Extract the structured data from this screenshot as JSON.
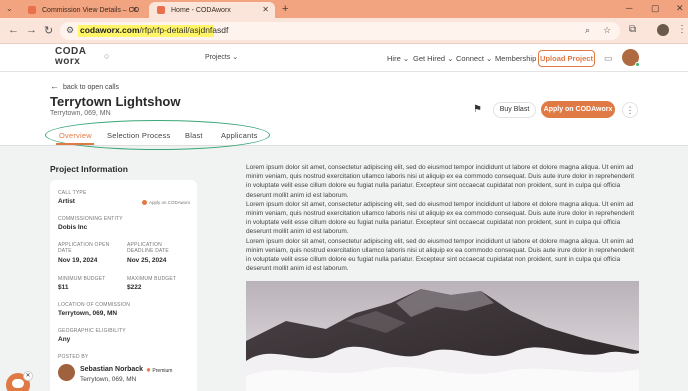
{
  "browser": {
    "tabs": [
      {
        "title": "Commission View Details – CO"
      },
      {
        "title": "Home - CODAworx"
      }
    ],
    "url_domain": "codaworx.com",
    "url_path": "/rfp/rfp-detail/asjdnfasdf"
  },
  "header": {
    "logo": "CODA worx",
    "search_scope": "Projects",
    "nav": [
      "Hire",
      "Get Hired",
      "Connect",
      "Membership"
    ],
    "upload_label": "Upload Project"
  },
  "project": {
    "back_label": "back to open calls",
    "title": "Terrytown Lightshow",
    "location": "Terrytown, 069, MN",
    "buy_label": "Buy Blast",
    "apply_label": "Apply on CODAworx"
  },
  "tabs": [
    "Overview",
    "Selection Process",
    "Blast",
    "Applicants"
  ],
  "info": {
    "heading": "Project Information",
    "call_type_label": "CALL TYPE",
    "call_type": "Artist",
    "apply_note": "Apply on CODAworx",
    "entity_label": "COMMISSIONING ENTITY",
    "entity": "Dobis Inc",
    "open_label": "APPLICATION OPEN DATE",
    "open_date": "Nov 19, 2024",
    "deadline_label": "APPLICATION DEADLINE DATE",
    "deadline": "Nov 25, 2024",
    "min_label": "MINIMUM BUDGET",
    "min": "$11",
    "max_label": "MAXIMUM BUDGET",
    "max": "$222",
    "loc_label": "LOCATION OF COMMISSION",
    "loc": "Terrytown, 069, MN",
    "geo_label": "GEOGRAPHIC ELIGIBILITY",
    "geo": "Any",
    "posted_label": "POSTED BY",
    "posted_name": "Sebastian Norback",
    "premium": "Premium",
    "posted_loc": "Terrytown, 069, MN"
  },
  "description": [
    "Lorem ipsum dolor sit amet, consectetur adipiscing elit, sed do eiusmod tempor incididunt ut labore et dolore magna aliqua. Ut enim ad minim veniam, quis nostrud exercitation ullamco laboris nisi ut aliquip ex ea commodo consequat. Duis aute irure dolor in reprehenderit in voluptate velit esse cillum dolore eu fugiat nulla pariatur. Excepteur sint occaecat cupidatat non proident, sunt in culpa qui officia deserunt mollit anim id est laborum.",
    "Lorem ipsum dolor sit amet, consectetur adipiscing elit, sed do eiusmod tempor incididunt ut labore et dolore magna aliqua. Ut enim ad minim veniam, quis nostrud exercitation ullamco laboris nisi ut aliquip ex ea commodo consequat. Duis aute irure dolor in reprehenderit in voluptate velit esse cillum dolore eu fugiat nulla pariatur. Excepteur sint occaecat cupidatat non proident, sunt in culpa qui officia deserunt mollit anim id est laborum.",
    "Lorem ipsum dolor sit amet, consectetur adipiscing elit, sed do eiusmod tempor incididunt ut labore et dolore magna aliqua. Ut enim ad minim veniam, quis nostrud exercitation ullamco laboris nisi ut aliquip ex ea commodo consequat. Duis aute irure dolor in reprehenderit in voluptate velit esse cillum dolore eu fugiat nulla pariatur. Excepteur sint occaecat cupidatat non proident, sunt in culpa qui officia deserunt mollit anim id est laborum."
  ],
  "colors": {
    "accent": "#e07a45",
    "tab_strip": "#f2a37f",
    "highlight": "#fff566",
    "annotation": "#3aa679"
  }
}
